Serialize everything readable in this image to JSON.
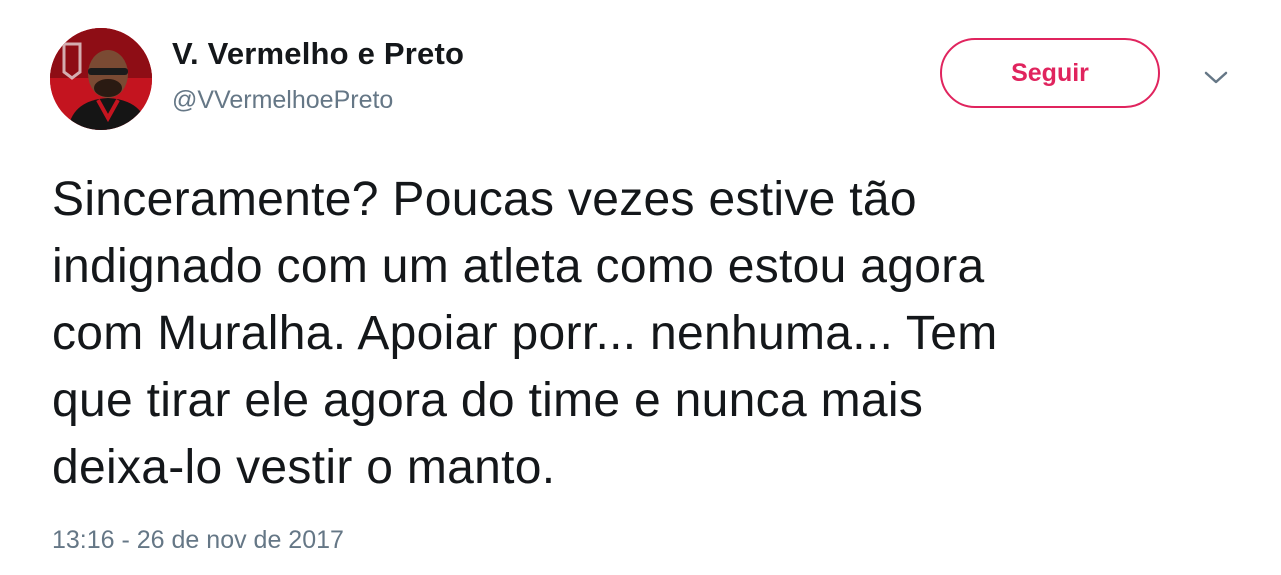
{
  "tweet": {
    "display_name": "V. Vermelho e Preto",
    "handle": "@VVermelhoePreto",
    "follow_label": "Seguir",
    "text_lines": [
      "Sinceramente? Poucas vezes estive tão",
      "indignado com um atleta como estou agora",
      "com Muralha. Apoiar porr... nenhuma... Tem",
      "que tirar ele agora do time e nunca mais",
      "deixa-lo vestir o manto."
    ],
    "timestamp": "13:16 - 26 de nov de 2017"
  },
  "icons": {
    "more": "chevron-down-icon",
    "avatar": "avatar"
  },
  "colors": {
    "accent": "#e0245e",
    "text": "#14171a",
    "muted": "#657786",
    "avatar_bg": "#b3121d"
  }
}
